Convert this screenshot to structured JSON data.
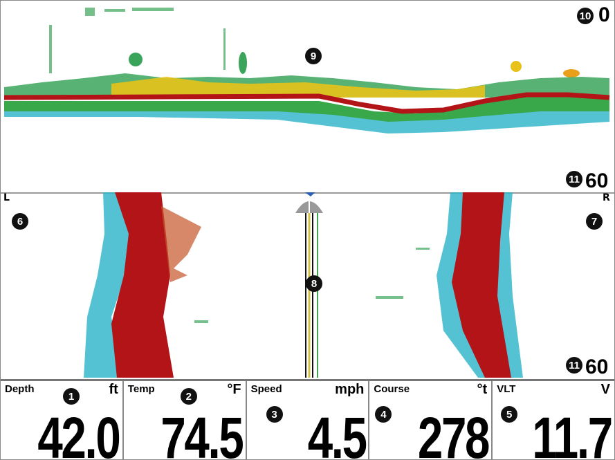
{
  "down_imaging": {
    "scale_top": "0",
    "scale_bottom": "60",
    "callouts": {
      "top_scale": "10",
      "bottom_scale": "11",
      "water_column": "9"
    }
  },
  "side_imaging": {
    "left_letter": "L",
    "right_letter": "R",
    "scale_bottom": "60",
    "callouts": {
      "left": "6",
      "right": "7",
      "center": "8",
      "bottom_scale": "11"
    }
  },
  "data_boxes": [
    {
      "label": "Depth",
      "unit": "ft",
      "value": "42.0",
      "callout": "1"
    },
    {
      "label": "Temp",
      "unit": "°F",
      "value": "74.5",
      "callout": "2"
    },
    {
      "label": "Speed",
      "unit": "mph",
      "value": "4.5",
      "callout": "3"
    },
    {
      "label": "Course",
      "unit": "°t",
      "value": "278",
      "callout": "4"
    },
    {
      "label": "VLT",
      "unit": "V",
      "value": "11.7",
      "callout": "5"
    }
  ],
  "colors": {
    "sonar_red": "#b21418",
    "sonar_yellow": "#e8c21a",
    "sonar_green": "#38a84a",
    "sonar_cyan": "#2bb3c8",
    "boat_icon_blue": "#2d5fb0"
  }
}
